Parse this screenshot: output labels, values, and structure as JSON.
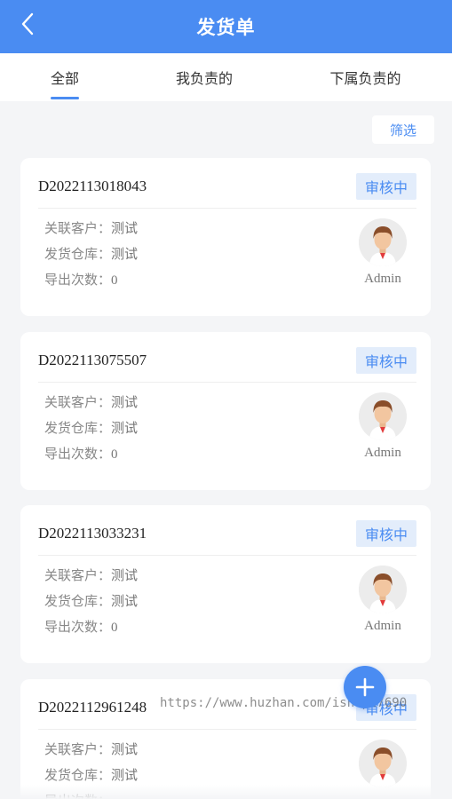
{
  "header": {
    "title": "发货单",
    "back_icon": "chevron-left-icon"
  },
  "tabs": [
    {
      "label": "全部",
      "active": true
    },
    {
      "label": "我负责的",
      "active": false
    },
    {
      "label": "下属负责的",
      "active": false
    }
  ],
  "filter": {
    "label": "筛选"
  },
  "field_labels": {
    "customer": "关联客户：",
    "warehouse": "发货仓库：",
    "export_count": "导出次数："
  },
  "orders": [
    {
      "id": "D2022113018043",
      "status": "审核中",
      "customer": "测试",
      "warehouse": "测试",
      "export_count": "0",
      "owner": "Admin"
    },
    {
      "id": "D2022113075507",
      "status": "审核中",
      "customer": "测试",
      "warehouse": "测试",
      "export_count": "0",
      "owner": "Admin"
    },
    {
      "id": "D2022113033231",
      "status": "审核中",
      "customer": "测试",
      "warehouse": "测试",
      "export_count": "0",
      "owner": "Admin"
    },
    {
      "id": "D2022112961248",
      "status": "审核中",
      "customer": "测试",
      "warehouse": "测试",
      "export_count": "",
      "owner": ""
    }
  ],
  "fab": {
    "icon": "plus-icon"
  },
  "watermark": "https://www.huzhan.com/ishop27690",
  "colors": {
    "primary": "#4a8cf2",
    "badge_bg": "#e3edfb",
    "page_bg": "#f4f5f7"
  }
}
